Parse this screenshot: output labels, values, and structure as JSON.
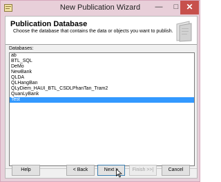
{
  "window": {
    "title": "New Publication Wizard",
    "minimize_glyph": "—",
    "maximize_glyph": "□",
    "close_glyph": "✕"
  },
  "header": {
    "title": "Publication Database",
    "subtitle": "Choose the database that contains the data or objects you want to publish."
  },
  "databases": {
    "label": "Databases:",
    "items": [
      "ab",
      "BTL_SQL",
      "DeMo",
      "NewBank",
      "QLDA",
      "QLHangBan",
      "QLyDiem_HAUI_BTL_CSDLPhanTan_Tram2",
      "QuanLyBank",
      "Test"
    ],
    "selected": "Test"
  },
  "buttons": {
    "help": "Help",
    "back": "< Back",
    "next": "Next >",
    "finish": "Finish >>|",
    "cancel": "Cancel"
  },
  "icons": {
    "app": "publication-app-icon",
    "wizard": "wizard-graphic-icon",
    "cursor": "mouse-pointer-icon"
  },
  "colors": {
    "selection": "#3399ff",
    "close_button": "#c7504c",
    "title_bar": "#e8cfd9"
  }
}
